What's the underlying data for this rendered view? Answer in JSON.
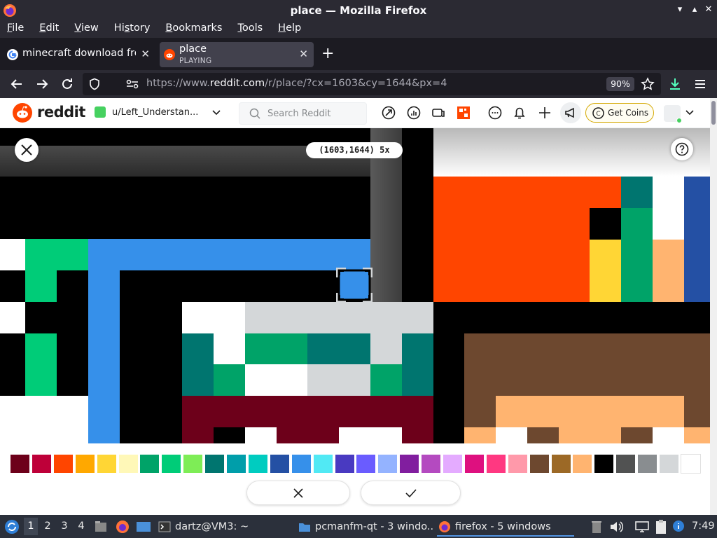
{
  "window": {
    "title": "place — Mozilla Firefox",
    "controls": {
      "minimize": "▾",
      "maximize": "▴",
      "close": "✕"
    }
  },
  "menubar": {
    "items": [
      {
        "label": "File",
        "u": "F",
        "rest": "ile"
      },
      {
        "label": "Edit",
        "u": "E",
        "rest": "dit"
      },
      {
        "label": "View",
        "u": "V",
        "rest": "iew"
      },
      {
        "label": "History",
        "pre": "Hi",
        "u": "s",
        "rest": "tory"
      },
      {
        "label": "Bookmarks",
        "u": "B",
        "rest": "ookmarks"
      },
      {
        "label": "Tools",
        "u": "T",
        "rest": "ools"
      },
      {
        "label": "Help",
        "u": "H",
        "rest": "elp"
      }
    ]
  },
  "tabs": [
    {
      "title": "minecraft download free",
      "icon": "google-icon"
    },
    {
      "title": "place",
      "subtitle": "PLAYING",
      "icon": "reddit-icon",
      "active": true
    }
  ],
  "toolbar": {
    "url_prefix": "https://www.",
    "url_host": "reddit.com",
    "url_path": "/r/place/?cx=1603&cy=1644&px=4",
    "zoom": "90%"
  },
  "reddit": {
    "wordmark": "reddit",
    "username": "u/Left_Understan...",
    "search_placeholder": "Search Reddit",
    "coins_label": "Get Coins",
    "brand_color": "#ff4500"
  },
  "place": {
    "coordinates": "(1603,1644) 5x",
    "selected_color": "#3690ea"
  },
  "palette": {
    "colors": [
      "#6d001a",
      "#be0039",
      "#ff4500",
      "#ffa800",
      "#ffd635",
      "#fff8b8",
      "#00a368",
      "#00cc78",
      "#7eed56",
      "#00756f",
      "#009eaa",
      "#00ccc0",
      "#2450a4",
      "#3690ea",
      "#51e9f4",
      "#493ac1",
      "#6a5cff",
      "#94b3ff",
      "#811e9f",
      "#b44ac0",
      "#e4abff",
      "#de107f",
      "#ff3881",
      "#ff99aa",
      "#6d482f",
      "#9c6926",
      "#ffb470",
      "#000000",
      "#515252",
      "#898d90",
      "#d4d7d9",
      "#ffffff"
    ]
  },
  "taskbar": {
    "workspaces": [
      "1",
      "2",
      "3",
      "4"
    ],
    "tasks": [
      {
        "label": "dartz@VM3: ~"
      },
      {
        "label": "pcmanfm-qt - 3 windo..."
      },
      {
        "label": "firefox - 5 windows"
      }
    ],
    "clock": "7:49"
  }
}
